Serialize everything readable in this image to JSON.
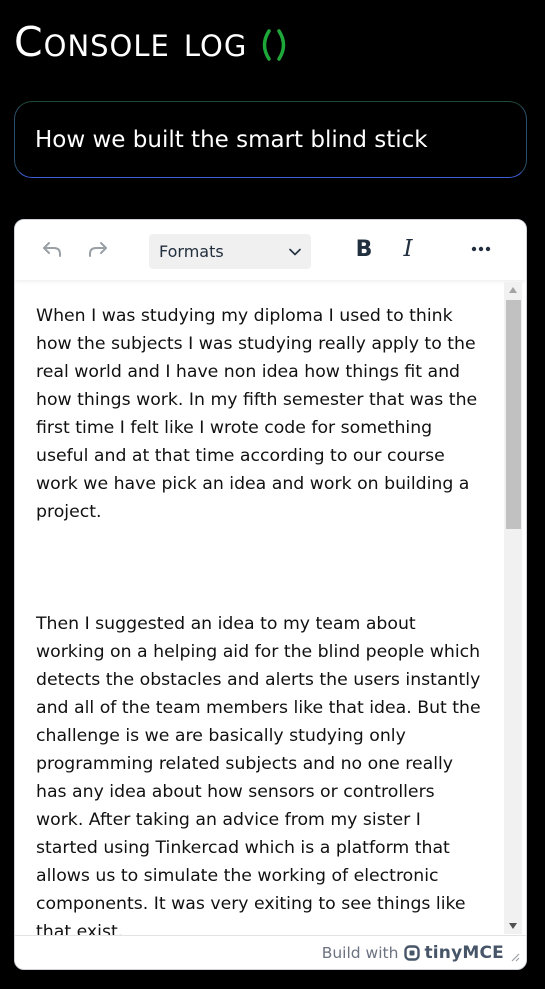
{
  "header": {
    "title": "Console log",
    "logo_color": "#1fa83a"
  },
  "post": {
    "title_value": "How we built the smart blind stick"
  },
  "editor": {
    "toolbar": {
      "formats_label": "Formats",
      "bold_label": "B",
      "italic_label": "I"
    },
    "paragraphs": [
      "When I was studying my diploma I used to think how the subjects I was studying really apply to the real world and I have non idea how things fit and how things work. In my fifth semester that was the first time I felt like I wrote code for something useful and at that time according to our course work we have pick an idea and work on building a project.",
      "Then I suggested an idea to my team about working on a helping aid for the blind people which detects the obstacles and alerts the users instantly and all of the team members like that idea. But the challenge is we are basically studying only programming related subjects and no one really has any idea about how sensors or controllers work. After taking an advice from my sister I started using Tinkercad which is a platform that allows us to simulate the working of electronic components. It was very exiting to see things like that exist."
    ],
    "statusbar": {
      "build_with": "Build with",
      "brand": "tinyMCE"
    }
  }
}
